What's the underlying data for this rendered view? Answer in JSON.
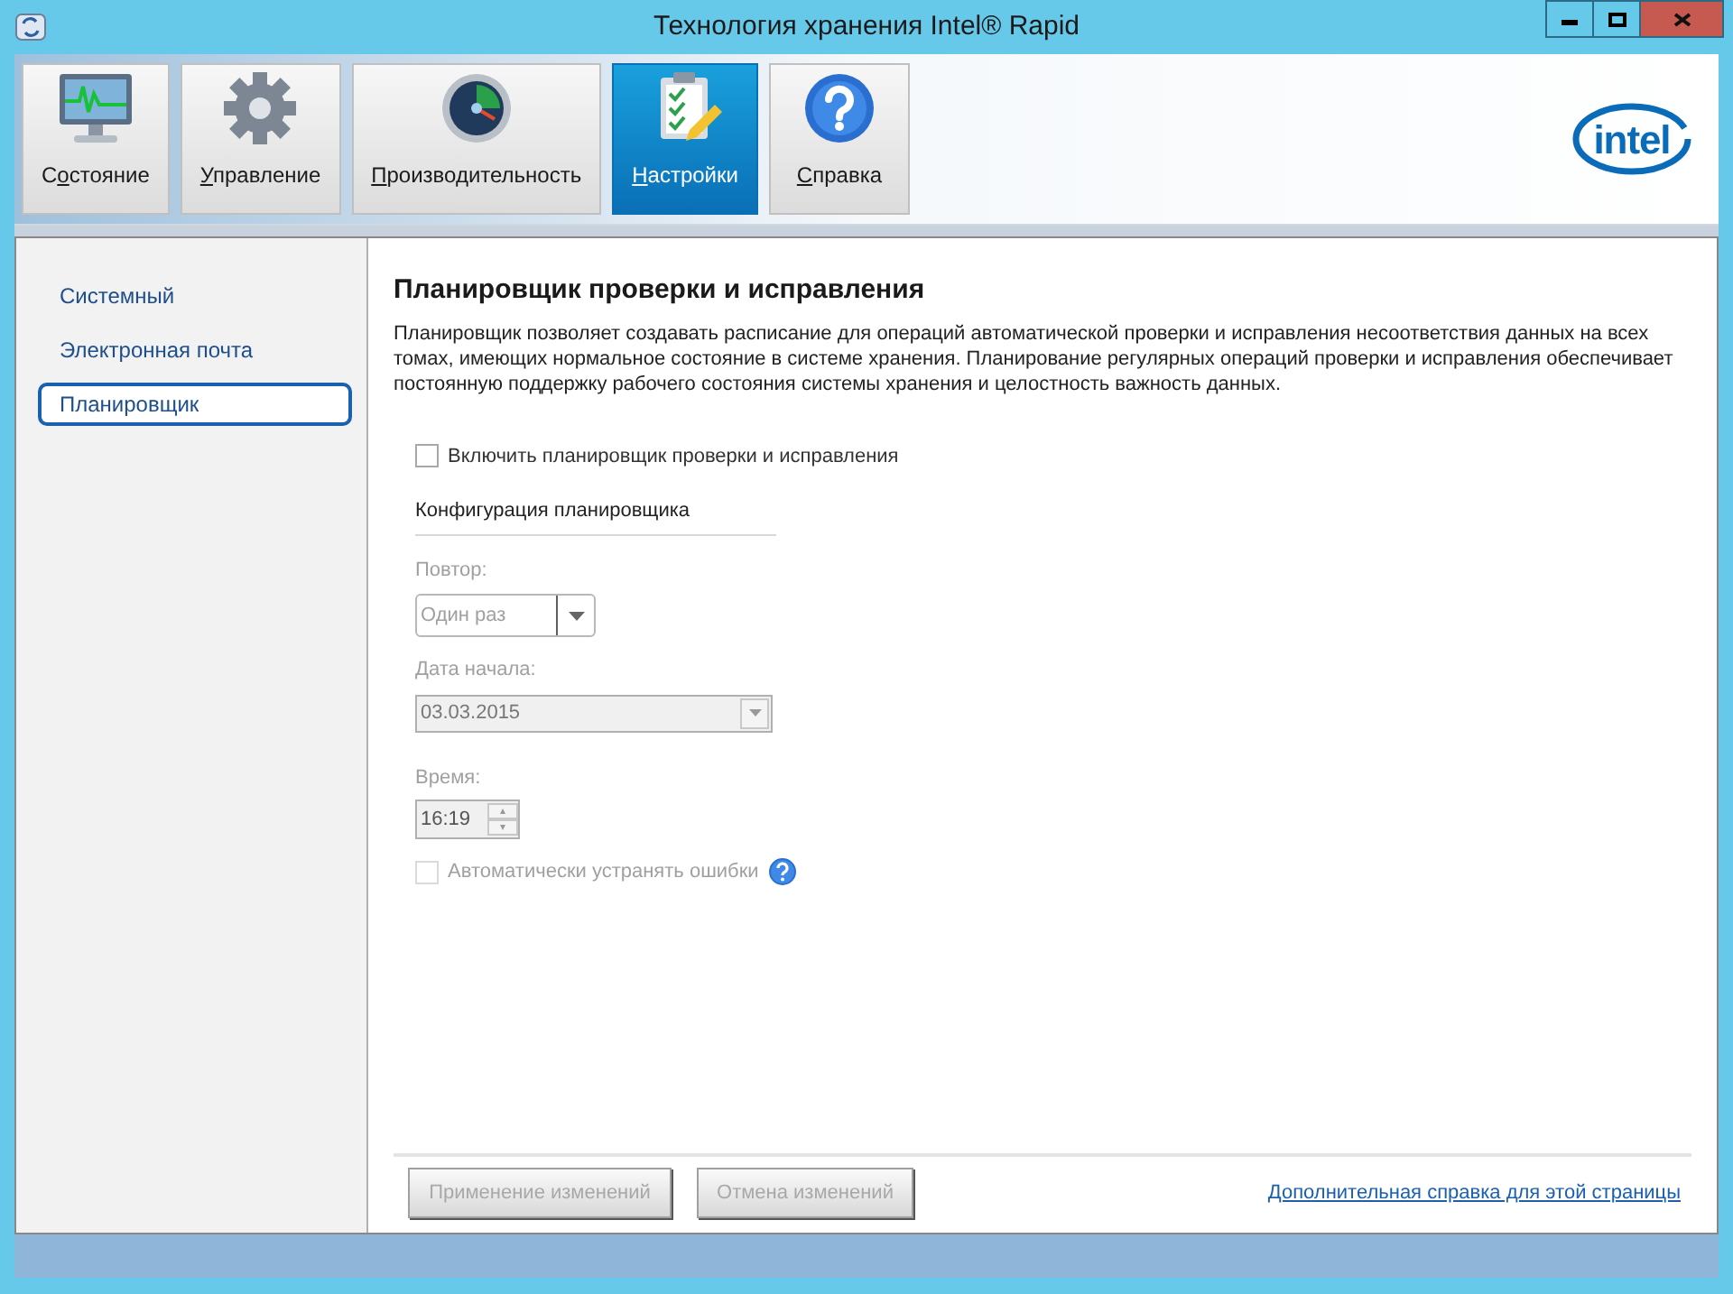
{
  "window": {
    "title": "Технология хранения Intel® Rapid"
  },
  "tabs": [
    {
      "kind": "monitor",
      "label_pre": "С",
      "access_key": "о",
      "label_post": "стояние",
      "selected": false
    },
    {
      "kind": "gear",
      "access_key": "У",
      "label_post": "правление",
      "selected": false
    },
    {
      "kind": "gauge",
      "access_key": "П",
      "label_post": "роизводительность",
      "selected": false
    },
    {
      "kind": "clipboard",
      "access_key": "Н",
      "label_post": "астройки",
      "selected": true
    },
    {
      "kind": "help",
      "access_key": "С",
      "label_post": "правка",
      "selected": false
    }
  ],
  "logo": "intel",
  "sidebar": {
    "items": [
      {
        "label": "Системный",
        "selected": false
      },
      {
        "label": "Электронная почта",
        "selected": false
      },
      {
        "label": "Планировщик",
        "selected": true
      }
    ]
  },
  "main": {
    "title": "Планировщик проверки и исправления",
    "description": "Планировщик позволяет создавать расписание для операций автоматической проверки и исправления несоответствия данных на всех томах, имеющих нормальное состояние в системе хранения. Планирование регулярных операций проверки и исправления обеспечивает постоянную поддержку рабочего состояния системы хранения и целостность важность данных.",
    "enable_checkbox": {
      "label": "Включить планировщик проверки и исправления",
      "checked": false
    },
    "section_title": "Конфигурация планировщика",
    "repeat": {
      "label": "Повтор:",
      "value": "Один раз",
      "disabled": true
    },
    "start_date": {
      "label": "Дата начала:",
      "value": "03.03.2015",
      "disabled": true
    },
    "time": {
      "label": "Время:",
      "value": "16:19",
      "disabled": true
    },
    "auto_fix": {
      "label": "Автоматически устранять ошибки",
      "checked": false,
      "disabled": true
    }
  },
  "footer": {
    "buttons": [
      {
        "label": "Применение изменений",
        "disabled": true
      },
      {
        "label": "Отмена изменений",
        "disabled": true
      }
    ],
    "help_link": "Дополнительная справка для этой страницы"
  }
}
